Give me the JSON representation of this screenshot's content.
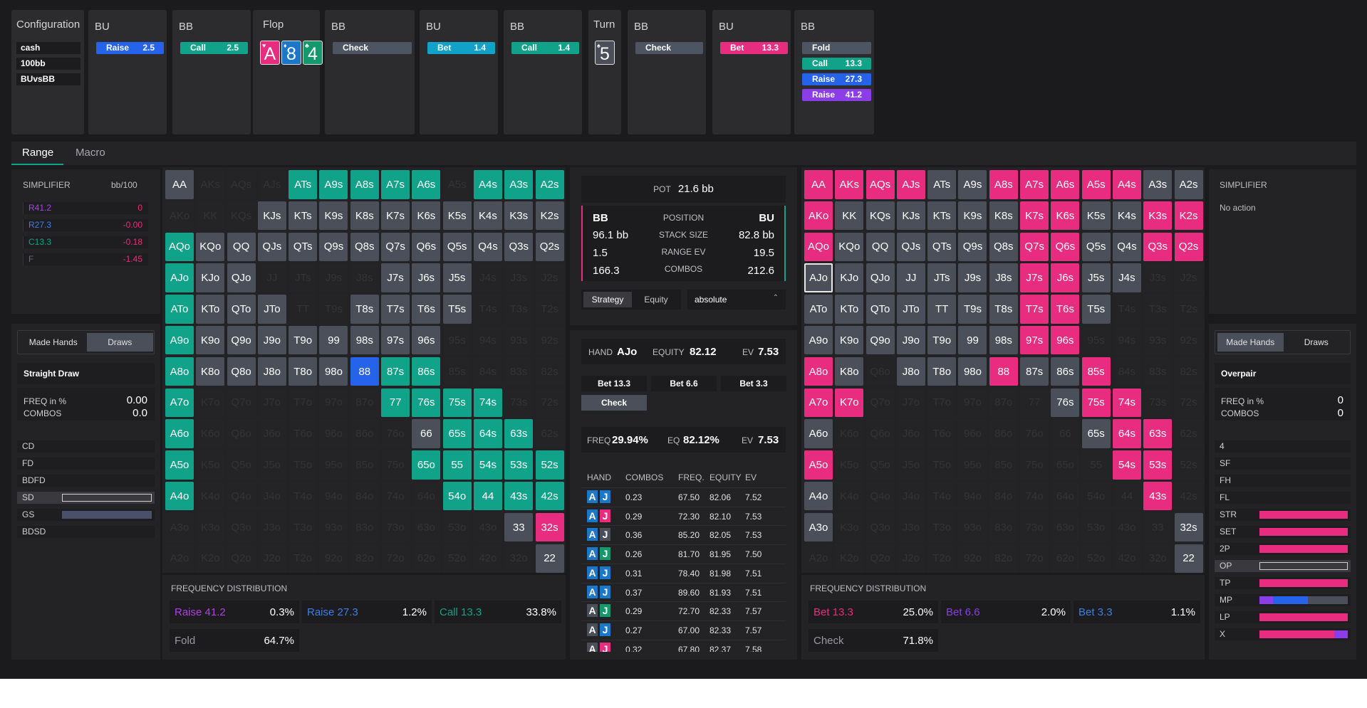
{
  "config": {
    "title": "Configuration",
    "items": [
      "cash",
      "100bb",
      "BUvsBB"
    ]
  },
  "nodes": [
    {
      "label": "BU",
      "actions": [
        {
          "name": "Raise",
          "amt": "2.5",
          "color": "#2563eb"
        }
      ]
    },
    {
      "label": "BB",
      "actions": [
        {
          "name": "Call",
          "amt": "2.5",
          "color": "#10a38a"
        }
      ]
    },
    {
      "label": "BB",
      "actions": [
        {
          "name": "Check",
          "amt": "",
          "color": "#4e5562"
        }
      ]
    },
    {
      "label": "BU",
      "actions": [
        {
          "name": "Bet",
          "amt": "1.4",
          "color": "#11a1c9"
        }
      ]
    },
    {
      "label": "BB",
      "actions": [
        {
          "name": "Call",
          "amt": "1.4",
          "color": "#10a38a"
        }
      ]
    },
    {
      "label": "BB",
      "actions": [
        {
          "name": "Check",
          "amt": "",
          "color": "#4e5562"
        }
      ]
    },
    {
      "label": "BU",
      "actions": [
        {
          "name": "Bet",
          "amt": "13.3",
          "color": "#e82c80"
        }
      ]
    },
    {
      "label": "BB",
      "actions": [
        {
          "name": "Fold",
          "amt": "",
          "color": "#4e5562"
        },
        {
          "name": "Call",
          "amt": "13.3",
          "color": "#10a38a"
        },
        {
          "name": "Raise",
          "amt": "27.3",
          "color": "#2563eb"
        },
        {
          "name": "Raise",
          "amt": "41.2",
          "color": "#8b3de8"
        }
      ]
    }
  ],
  "flop": {
    "title": "Flop",
    "cards": [
      {
        "rank": "A",
        "suit": "♥",
        "color": "#e82c80"
      },
      {
        "rank": "8",
        "suit": "♦",
        "color": "#1b78c8"
      },
      {
        "rank": "4",
        "suit": "♣",
        "color": "#15986b"
      }
    ]
  },
  "turn": {
    "title": "Turn",
    "cards": [
      {
        "rank": "5",
        "suit": "♠",
        "color": "#4a4f5a"
      }
    ]
  },
  "tabs": [
    "Range",
    "Macro"
  ],
  "simplifier_left": {
    "title": "SIMPLIFIER",
    "unit": "bb/100",
    "rows": [
      {
        "label": "R41.2",
        "value": "0",
        "color": "#b23fe8",
        "vcolor": "#e82c80"
      },
      {
        "label": "R27.3",
        "value": "-0.00",
        "color": "#3d7fe8",
        "vcolor": "#e82c80"
      },
      {
        "label": "C13.3",
        "value": "-0.18",
        "color": "#11a38a",
        "vcolor": "#e82c80"
      },
      {
        "label": "F",
        "value": "-1.45",
        "color": "#6b6b70",
        "vcolor": "#e82c80"
      }
    ]
  },
  "left_filter": {
    "tabs": [
      "Made Hands",
      "Draws"
    ],
    "active": 1,
    "category": "Straight Draw",
    "freq_label": "FREQ in %",
    "freq_value": "0.00",
    "combos_label": "COMBOS",
    "combos_value": "0.0",
    "items": [
      {
        "label": "CD",
        "fill": 0
      },
      {
        "label": "FD",
        "fill": 0
      },
      {
        "label": "BDFD",
        "fill": 0
      },
      {
        "label": "SD",
        "fill": 0,
        "sel": true
      },
      {
        "label": "GS",
        "fill": 1,
        "color": "#4a4f6a"
      },
      {
        "label": "BDSD",
        "fill": 0
      }
    ]
  },
  "right_filter": {
    "tabs": [
      "Made Hands",
      "Draws"
    ],
    "active": 0,
    "category": "Overpair",
    "freq_label": "FREQ in %",
    "freq_value": "0",
    "combos_label": "COMBOS",
    "combos_value": "0",
    "items": [
      {
        "label": "4",
        "fill": 0
      },
      {
        "label": "SF",
        "fill": 0
      },
      {
        "label": "FH",
        "fill": 0
      },
      {
        "label": "FL",
        "fill": 0
      },
      {
        "label": "STR",
        "fill": 1,
        "color": "#e82c80"
      },
      {
        "label": "SET",
        "fill": 1,
        "color": "#e82c80"
      },
      {
        "label": "2P",
        "fill": 1,
        "color": "#e82c80"
      },
      {
        "label": "OP",
        "fill": 0,
        "sel": true
      },
      {
        "label": "TP",
        "fill": 1,
        "color": "#e82c80"
      },
      {
        "label": "MP",
        "fill": 0.55,
        "color": "#2563eb",
        "pre": 0.15,
        "precolor": "#8b3de8",
        "rest": "#4a4f5a"
      },
      {
        "label": "LP",
        "fill": 1,
        "color": "#e82c80"
      },
      {
        "label": "X",
        "fill": 0.85,
        "color": "#e82c80",
        "post": "#8b3de8"
      }
    ]
  },
  "simplifier_right": {
    "title": "SIMPLIFIER",
    "text": "No action"
  },
  "info": {
    "pot_label": "POT",
    "pot": "21.6 bb",
    "left_pos": "BB",
    "right_pos": "BU",
    "rows": [
      {
        "l": "96.1 bb",
        "m": "STACK SIZE",
        "r": "82.8 bb"
      },
      {
        "l": "1.5",
        "m": "RANGE EV",
        "r": "19.5"
      },
      {
        "l": "166.3",
        "m": "COMBOS",
        "r": "212.6"
      }
    ],
    "pos_label": "POSITION",
    "tabs": [
      "Strategy",
      "Equity"
    ],
    "dropdown": "absolute"
  },
  "hand": {
    "hand_label": "HAND",
    "hand": "AJo",
    "equity_label": "EQUITY",
    "equity": "82.12",
    "ev_label": "EV",
    "ev": "7.53",
    "bets": [
      "Bet 13.3",
      "Bet 6.6",
      "Bet 3.3"
    ],
    "check": "Check",
    "freq_label": "FREQ",
    "freq": "29.94%",
    "eq_label": "EQ",
    "eq": "82.12%",
    "ev2_label": "EV",
    "ev2": "7.53"
  },
  "combo_table": {
    "headers": [
      "HAND",
      "COMBOS",
      "FREQ.",
      "EQUITY",
      "EV"
    ],
    "rows": [
      {
        "s1": "#1b78c8",
        "s2": "#1b78c8",
        "c": "0.23",
        "f": "67.50",
        "e": "82.06",
        "v": "7.52"
      },
      {
        "s1": "#1b78c8",
        "s2": "#e82c80",
        "c": "0.29",
        "f": "72.30",
        "e": "82.10",
        "v": "7.53"
      },
      {
        "s1": "#1b78c8",
        "s2": "#4a4f5a",
        "c": "0.36",
        "f": "85.20",
        "e": "82.05",
        "v": "7.53"
      },
      {
        "s1": "#1b78c8",
        "s2": "#15986b",
        "c": "0.26",
        "f": "81.70",
        "e": "81.95",
        "v": "7.50"
      },
      {
        "s1": "#1b78c8",
        "s2": "#1b78c8",
        "c": "0.31",
        "f": "78.40",
        "e": "81.98",
        "v": "7.51"
      },
      {
        "s1": "#1b78c8",
        "s2": "#1b78c8",
        "c": "0.37",
        "f": "89.60",
        "e": "81.93",
        "v": "7.51"
      },
      {
        "s1": "#4a4f5a",
        "s2": "#15986b",
        "c": "0.29",
        "f": "72.70",
        "e": "82.33",
        "v": "7.57"
      },
      {
        "s1": "#4a4f5a",
        "s2": "#1b78c8",
        "c": "0.27",
        "f": "67.00",
        "e": "82.33",
        "v": "7.57"
      },
      {
        "s1": "#4a4f5a",
        "s2": "#e82c80",
        "c": "0.32",
        "f": "67.80",
        "e": "82.37",
        "v": "7.58"
      }
    ]
  },
  "left_dist": {
    "title": "FREQUENCY DISTRIBUTION",
    "items": [
      {
        "label": "Raise 41.2",
        "value": "0.3%",
        "color": "#b23fe8"
      },
      {
        "label": "Raise 27.3",
        "value": "1.2%",
        "color": "#3d7fe8"
      },
      {
        "label": "Call 13.3",
        "value": "33.8%",
        "color": "#11a38a"
      },
      {
        "label": "Fold",
        "value": "64.7%",
        "color": "#9a9a9e"
      }
    ]
  },
  "right_dist": {
    "title": "FREQUENCY DISTRIBUTION",
    "items": [
      {
        "label": "Bet 13.3",
        "value": "25.0%",
        "color": "#e82c80"
      },
      {
        "label": "Bet 6.6",
        "value": "2.0%",
        "color": "#8b3de8"
      },
      {
        "label": "Bet 3.3",
        "value": "1.1%",
        "color": "#3d7fe8"
      },
      {
        "label": "Check",
        "value": "71.8%",
        "color": "#9a9a9e"
      }
    ]
  },
  "left_grid": "sNNNaaaaaNaaa,NNNnnnnnnnnnn,annnnnnnnnnnn,annNNNNnnnNNN,annnNNnnnnNNN,annnnnnnnNNNN,annnnnbaaNNNN,aNNNNNNaaaaNN,aNNNNNNNnaaaN,aNNNNNNNaaaaa,aNNNNNNNNaaaa,NNNNNNNNNNNnp,NNNNNNNNNNNNn",
  "right_grid": "ppppnnpppppnn,pnnnnnnppnnpp,pnnnnnnppnnpp,wnnnnnnppnnNN,nnnnnnnppnNNN,nnnnnnnppNNNN,pnNnnnpnnpNNN,ppNNNNNNnppNN,nNNNNNNNNnppN,pNNNNNNNNNppN,nNNNNNNNNNNpN,nNNNNNNNNNNNn,NNNNNNNNNNNNn"
}
